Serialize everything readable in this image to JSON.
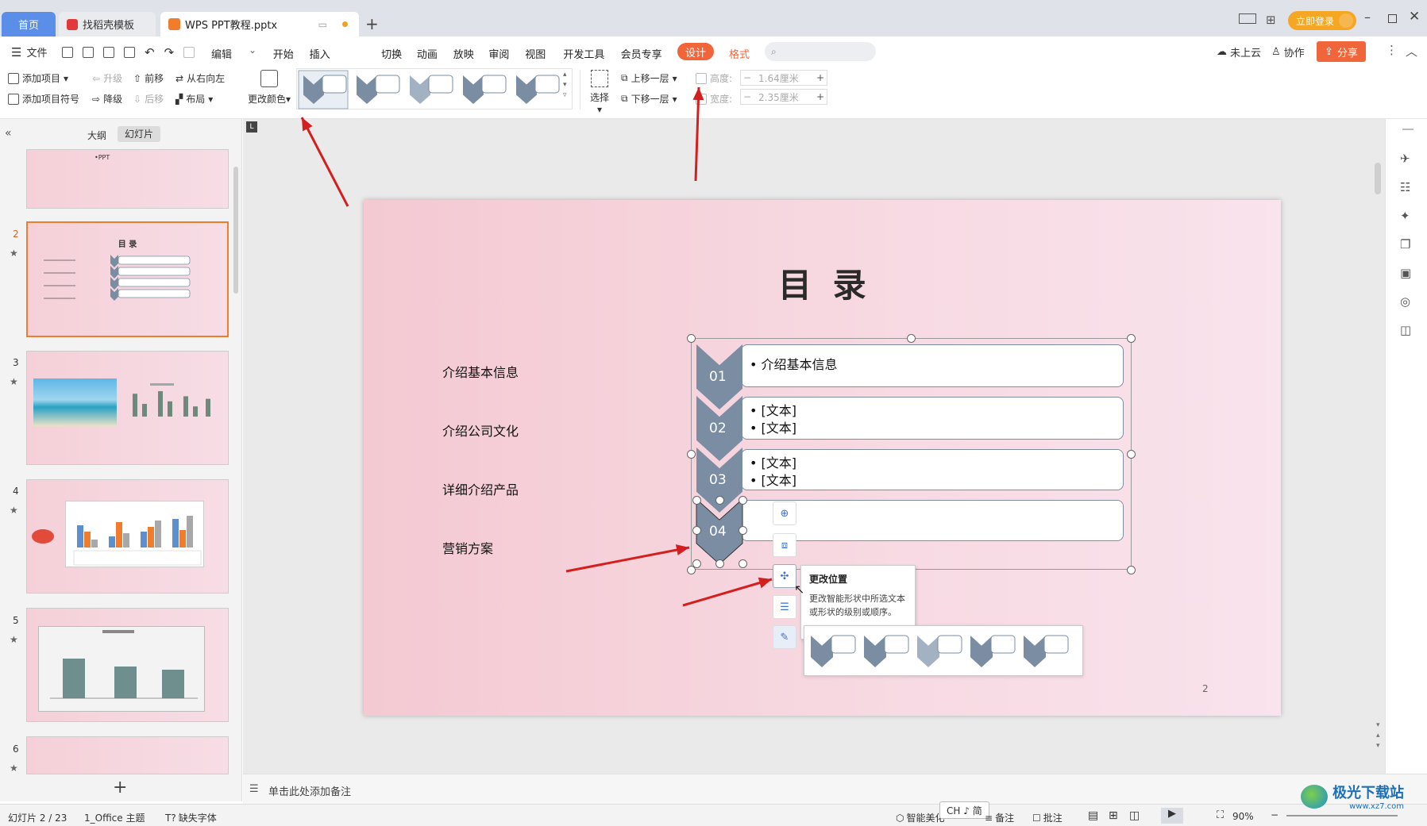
{
  "titlebar": {
    "home_tab": "首页",
    "template_tab": "找稻壳模板",
    "doc_tab": "WPS PPT教程.pptx",
    "new_tab": "+",
    "login_button": "立即登录"
  },
  "menubar": {
    "file": "文件",
    "edit": "编辑",
    "items": [
      "开始",
      "插入",
      "设计",
      "切换",
      "动画",
      "放映",
      "审阅",
      "视图",
      "开发工具",
      "会员专享"
    ],
    "design_active": "设计",
    "format": "格式",
    "search_placeholder": "",
    "cloud": "未上云",
    "collab": "协作",
    "share": "分享"
  },
  "toolbar": {
    "add_item": "添加项目",
    "add_bullet": "添加项目符号",
    "promote": "升级",
    "demote": "降级",
    "move_forward": "前移",
    "move_back": "后移",
    "rtl": "从右向左",
    "layout": "布局",
    "change_color": "更改颜色",
    "select": "选择",
    "bring_forward": "上移一层",
    "send_backward": "下移一层",
    "height_label": "高度:",
    "height_value": "1.64厘米",
    "width_label": "宽度:",
    "width_value": "2.35厘米"
  },
  "leftpane": {
    "outline_tab": "大纲",
    "slides_tab": "幻灯片",
    "thumb1_text": "•PPT",
    "thumb2_title": "目 录",
    "thumb_nums": [
      "2",
      "3",
      "4",
      "5",
      "6"
    ],
    "add_slide": "+"
  },
  "slide": {
    "title": "目 录",
    "left_items": [
      "介绍基本信息",
      "介绍公司文化",
      "详细介绍产品",
      "营销方案"
    ],
    "numbers": [
      "01",
      "02",
      "03",
      "04"
    ],
    "box1": [
      "• 介绍基本信息"
    ],
    "box2": [
      "• [文本]",
      "• [文本]"
    ],
    "box3": [
      "• [文本]",
      "• [文本]"
    ],
    "box4": [],
    "page_number": "2"
  },
  "tooltip": {
    "title": "更改位置",
    "body": "更改智能形状中所选文本或形状的级别或顺序。"
  },
  "notes": {
    "placeholder": "单击此处添加备注"
  },
  "status": {
    "slide_info": "幻灯片 2 / 23",
    "theme": "1_Office 主题",
    "missing_font": "缺失字体",
    "smart": "智能美化",
    "ime": "CH ♪ 简",
    "notes": "备注",
    "comments": "批注",
    "zoom": "90%"
  },
  "watermark": {
    "text": "极光下载站",
    "url": "www.xz7.com"
  },
  "colors": {
    "accent": "#f0653a",
    "chevron": "#7a8da3",
    "slide_pink": "#f4c9d2",
    "arrow_red": "#d41f1f"
  }
}
